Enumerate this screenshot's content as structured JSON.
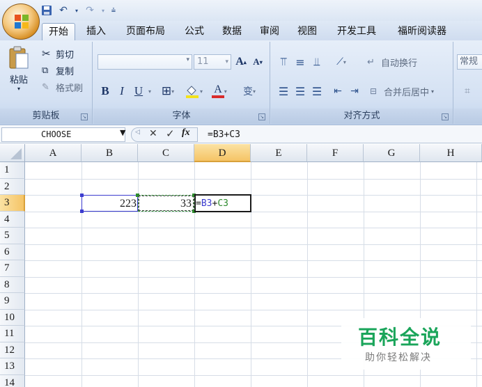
{
  "quick_access": {
    "save_icon": "save-icon",
    "undo_icon": "undo-icon",
    "redo_icon": "redo-icon",
    "customize_icon": "customize-qat-icon"
  },
  "tabs": [
    {
      "label": "开始",
      "active": true
    },
    {
      "label": "插入"
    },
    {
      "label": "页面布局"
    },
    {
      "label": "公式"
    },
    {
      "label": "数据"
    },
    {
      "label": "审阅"
    },
    {
      "label": "视图"
    },
    {
      "label": "开发工具"
    },
    {
      "label": "福昕阅读器"
    }
  ],
  "ribbon": {
    "clipboard": {
      "label": "剪贴板",
      "paste": "粘贴",
      "cut": "剪切",
      "copy": "复制",
      "format_painter": "格式刷"
    },
    "font": {
      "label": "字体",
      "font_name": "",
      "font_size": "11",
      "bold": "B",
      "italic": "I",
      "underline": "U",
      "grow_font": "A",
      "shrink_font": "A",
      "font_color": "A",
      "phonetic": "变"
    },
    "alignment": {
      "label": "对齐方式",
      "wrap_text": "自动换行",
      "merge_center": "合并后居中"
    },
    "number": {
      "format": "常规"
    }
  },
  "formula_bar": {
    "name_box": "CHOOSE",
    "cancel": "✕",
    "enter": "✓",
    "fx": "fx",
    "formula": "=B3+C3"
  },
  "sheet": {
    "columns": [
      "A",
      "B",
      "C",
      "D",
      "E",
      "F",
      "G",
      "H"
    ],
    "rows": [
      "1",
      "2",
      "3",
      "4",
      "5",
      "6",
      "7",
      "8",
      "9",
      "10",
      "11",
      "12",
      "13",
      "14"
    ],
    "active_cell": "D3",
    "cells": {
      "B3": "223",
      "C3": "33",
      "D3_ref1": "B3",
      "D3_plus": "+",
      "D3_ref2": "C3",
      "D3_eq": "="
    },
    "ref_colors": {
      "B3": "#3c3ccf",
      "C3": "#2e8b2e"
    }
  },
  "watermark": {
    "title": "百科全说",
    "subtitle": "助你轻松解决",
    "title_color": "#1aa55a"
  }
}
